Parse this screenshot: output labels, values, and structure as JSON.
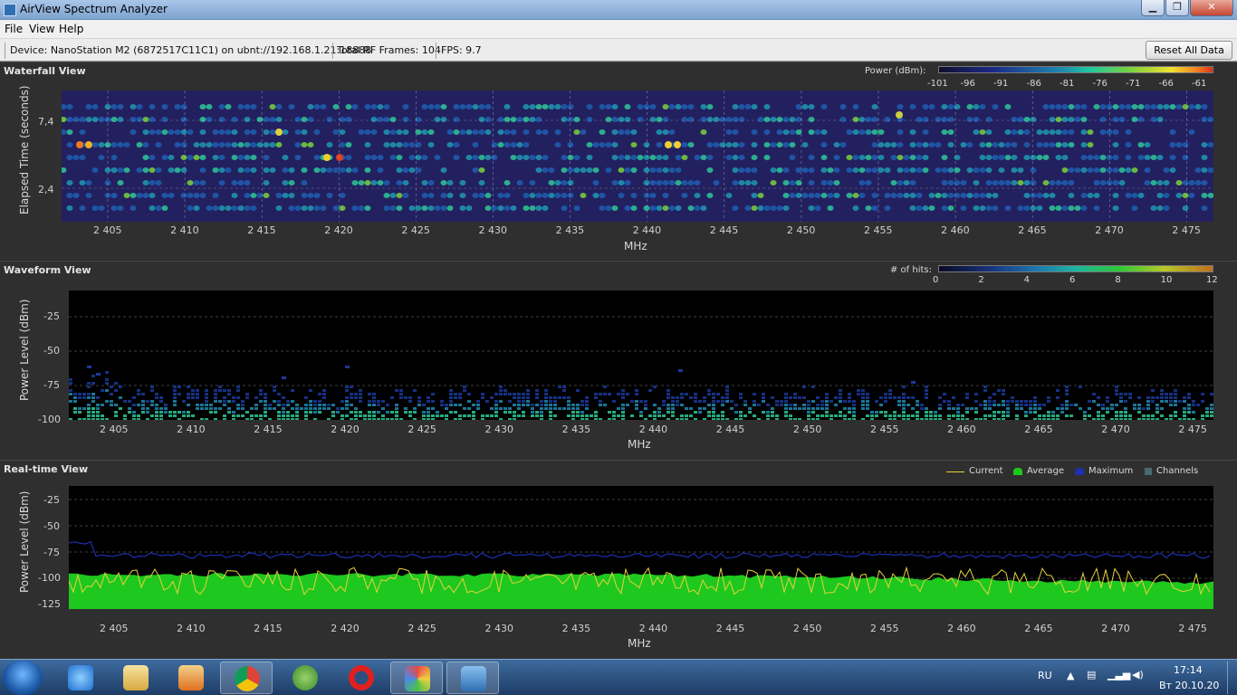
{
  "window": {
    "title": "AirView Spectrum Analyzer"
  },
  "menu": {
    "file": "File",
    "view": "View",
    "help": "Help"
  },
  "status": {
    "device": "Device: NanoStation M2 (6872517C11C1) on ubnt://192.168.1.21:18888",
    "frames": "Total RF Frames: 104",
    "fps": "FPS: 9.7",
    "reset_label": "Reset All Data"
  },
  "x_ticks": [
    "2 405",
    "2 410",
    "2 415",
    "2 420",
    "2 425",
    "2 430",
    "2 435",
    "2 440",
    "2 445",
    "2 450",
    "2 455",
    "2 460",
    "2 465",
    "2 470",
    "2 475"
  ],
  "waterfall": {
    "title": "Waterfall View",
    "ylabel": "Elapsed Time (seconds)",
    "xlabel": "MHz",
    "y_ticks": [
      "7,4",
      "2,4"
    ],
    "legend_label": "Power (dBm):",
    "legend_ticks": [
      "-101",
      "-96",
      "-91",
      "-86",
      "-81",
      "-76",
      "-71",
      "-66",
      "-61"
    ]
  },
  "waveform": {
    "title": "Waveform View",
    "ylabel": "Power Level (dBm)",
    "xlabel": "MHz",
    "y_ticks": [
      "-25",
      "-50",
      "-75",
      "-100"
    ],
    "legend_label": "# of hits:",
    "legend_ticks": [
      "0",
      "2",
      "4",
      "6",
      "8",
      "10",
      "12"
    ]
  },
  "realtime": {
    "title": "Real-time View",
    "ylabel": "Power Level (dBm)",
    "xlabel": "MHz",
    "y_ticks": [
      "-25",
      "-50",
      "-75",
      "-100",
      "-125"
    ],
    "legend": {
      "current": "Current",
      "average": "Average",
      "maximum": "Maximum",
      "channels": "Channels"
    }
  },
  "colors": {
    "current": "#e6d23c",
    "average": "#1ec81e",
    "maximum": "#1e2fb0",
    "channels": "#4a6b6b"
  },
  "taskbar": {
    "apps": [
      "ie-icon",
      "explorer-icon",
      "media-player-icon",
      "chrome-icon",
      "utorrent-icon",
      "opera-icon",
      "paint-icon",
      "airview-icon"
    ],
    "lang": "RU",
    "time": "17:14",
    "date": "Вт 20.10.20"
  }
}
